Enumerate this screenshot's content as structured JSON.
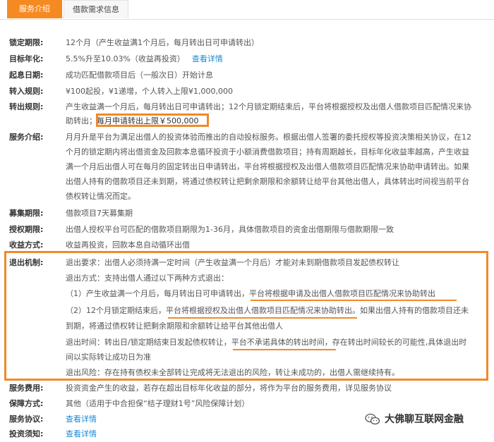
{
  "tabs": [
    {
      "label": "服务介绍",
      "active": true
    },
    {
      "label": "借款需求信息",
      "active": false
    }
  ],
  "rows": {
    "lock_period": {
      "label": "锁定期限:",
      "value": "12个月（产生收益满1个月后，每月转出日可申请转出）"
    },
    "target_rate": {
      "label": "目标年化:",
      "value": "5.5%升至10.03%（收益再投资）",
      "link": "查看详情"
    },
    "start_date": {
      "label": "起息日期:",
      "value": "成功匹配借款项目后（一般次日）开始计息"
    },
    "transfer_in": {
      "label": "转入规则:",
      "value": "¥100起投，¥1递增，个人转入上限¥1,000,000"
    },
    "transfer_out": {
      "label": "转出规则:",
      "line1": "产生收益满一个月后，每月转出日可申请转出；12个月锁定期结束后，平台将根据授权及出借人借款项目匹配情况来协",
      "line2_prefix": "助转出；",
      "line2_boxed": "每月申请转出上限￥500,000"
    },
    "service_intro": {
      "label": "服务介绍:",
      "lines": [
        "月月升是平台为满足出借人的投资体验而推出的自动投标服务。根据出借人签署的委托授权等投资决策相关协议，在12",
        "个月的锁定期内将出借资金及回款本息循环投资于小额消费借款项目；持有周期越长，目标年化收益率越高，产生收益",
        "满一个月后出借人可在每月的固定转出日申请转出，平台将根据授权及出借人借款项目匹配情况来协助申请转出。如果",
        "出借人持有的借款项目还未到期，将通过债权转让把剩余期限和余额转让给平台其他出借人，具体转出时间视当前平台",
        "债权转让情况而定。"
      ]
    },
    "raise_period": {
      "label": "募集期限:",
      "value": "借款项目7天募集期"
    },
    "auth_period": {
      "label": "授权期限:",
      "value": "出借人授权平台可匹配的借款项目期限为1-36月，具体借款项目的资金出借期限与借款期限一致"
    },
    "income_method": {
      "label": "收益方式:",
      "value": "收益再投资，回款本息自动循环出借"
    },
    "exit_mechanism": {
      "label": "退出机制:",
      "requirement": "退出要求：出借人必须持满一定时间（产生收益满一个月后）才能对未到期借款项目发起债权转让",
      "method_title": "退出方式：支持出借人通过以下两种方式退出：",
      "method1": "（1）产生收益满一个月后，每月转出日可申请转出，平台将根据申请及出借人借款项目匹配情况来协助转出",
      "method2_line1": "（2）12个月锁定期结束后，平台将根据授权及出借人借款项目匹配情况来协助转出。如果出借人持有的借款项目还未",
      "method2_line2": "到期，将通过债权转让把剩余期限和余额转让给平台其他出借人",
      "time_line1": "退出时间：转出日/锁定期结束日发起债权转让，平台不承诺具体的转出时间，存在转出时间较长的可能性,具体退出时",
      "time_line2": "间以实际转让成功日为准",
      "risk": "退出风险：存在持有债权未全部转让完成将无法退出的风险，转让未成功的，出借人需继续持有。"
    },
    "service_fee": {
      "label": "服务费用:",
      "value": "投资资金产生的收益，若存在超出目标年化收益的部分，将作为平台的服务费用，详见服务协议"
    },
    "guarantee": {
      "label": "保障方式:",
      "value": "其他（适用于中合担保“桔子理财1号”风险保障计划）"
    },
    "service_agreement": {
      "label": "服务协议:",
      "link": "查看详情"
    },
    "investment_notice": {
      "label": "投资须知:",
      "link": "查看详情"
    }
  },
  "watermark": {
    "text": "大佛聊互联网金融",
    "icon": "wechat-icon"
  },
  "colors": {
    "accent": "#f58a23",
    "highlight_box": "#f08a2a",
    "link": "#1a8ad6"
  }
}
